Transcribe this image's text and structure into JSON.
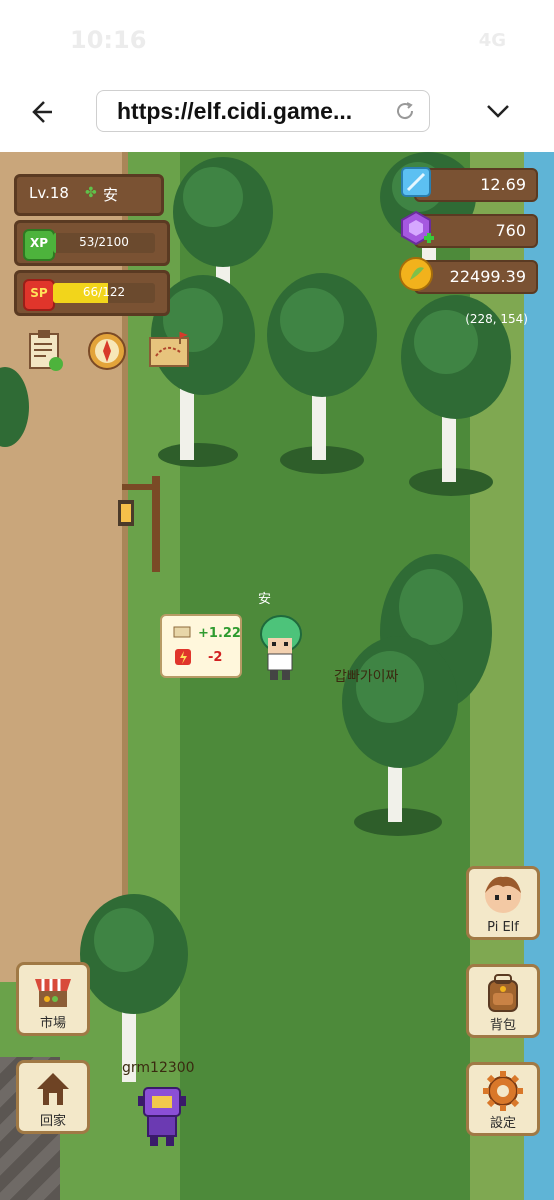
{
  "status_bar": {
    "time": "10:16",
    "network": "4G"
  },
  "browser": {
    "url": "https://elf.cidi.game..."
  },
  "hud": {
    "level_label": "Lv.18",
    "player_name": "安",
    "xp": {
      "icon_text": "XP",
      "text": "53/2100",
      "fraction": 0.025,
      "color": "#4db33c"
    },
    "sp": {
      "icon_text": "SP",
      "text": "66/122",
      "fraction": 0.54,
      "color": "#f2d51b"
    },
    "resources": [
      {
        "name": "crystal",
        "value": "12.69",
        "icon": "blue-crystal-icon"
      },
      {
        "name": "gem",
        "value": "760",
        "icon": "purple-gem-icon"
      },
      {
        "name": "coin",
        "value": "22499.39",
        "icon": "gold-coin-icon"
      }
    ],
    "coords": "(228, 154)"
  },
  "player": {
    "name": "安",
    "bubble": {
      "gain": "+1.22",
      "sp_cost": "-2"
    }
  },
  "other_players": [
    {
      "name": "갑빠가이짜"
    },
    {
      "name": "grm12300"
    }
  ],
  "buttons": {
    "market": "市場",
    "home": "回家",
    "pi_elf": "Pi Elf",
    "backpack": "背包",
    "settings": "設定"
  }
}
